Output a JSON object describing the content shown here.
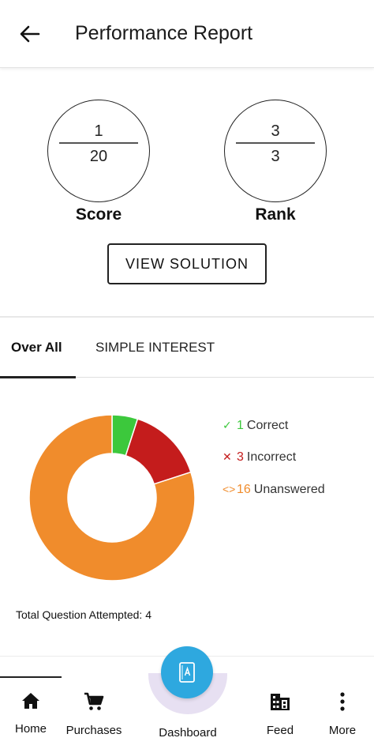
{
  "header": {
    "title": "Performance Report",
    "back_icon": "arrow-left-icon"
  },
  "score": {
    "numerator": "1",
    "denominator": "20",
    "label": "Score"
  },
  "rank": {
    "numerator": "3",
    "denominator": "3",
    "label": "Rank"
  },
  "view_solution_label": "VIEW SOLUTION",
  "tabs": [
    {
      "label": "Over All",
      "active": true
    },
    {
      "label": "SIMPLE INTEREST",
      "active": false
    }
  ],
  "chart_data": {
    "type": "pie",
    "categories": [
      "Correct",
      "Incorrect",
      "Unanswered"
    ],
    "values": [
      1,
      3,
      16
    ],
    "colors": [
      "#3cc83c",
      "#c41c1c",
      "#f08c2c"
    ],
    "donut": true,
    "legend_placement": "right"
  },
  "legend": [
    {
      "symbol": "✓",
      "count": "1",
      "label": "Correct",
      "color": "#3cc83c"
    },
    {
      "symbol": "✕",
      "count": "3",
      "label": "Incorrect",
      "color": "#c41c1c"
    },
    {
      "symbol": "<>",
      "count": "16",
      "label": "Unanswered",
      "color": "#f08c2c"
    }
  ],
  "total_attempted": "Total Question Attempted: 4",
  "bottom_nav": {
    "home": "Home",
    "purchases": "Purchases",
    "dashboard": "Dashboard",
    "feed": "Feed",
    "more": "More",
    "fab_color": "#2ea8df"
  }
}
